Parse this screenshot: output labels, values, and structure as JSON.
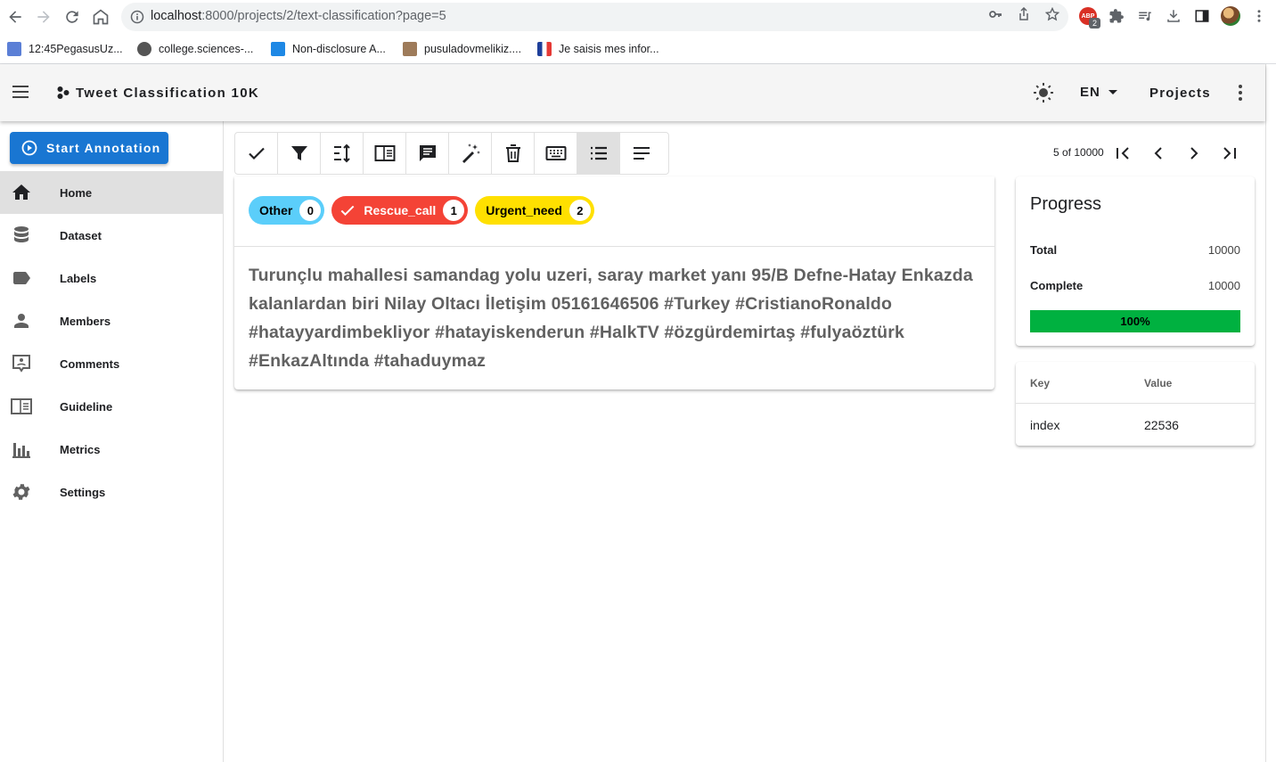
{
  "browser": {
    "url_host": "localhost",
    "url_rest": ":8000/projects/2/text-classification?page=5",
    "abp_label": "ABP",
    "abp_count": "2",
    "bookmarks": [
      {
        "label": "12:45PegasusUz...",
        "color": "#5b7fd6"
      },
      {
        "label": "college.sciences-...",
        "color": "#555555"
      },
      {
        "label": "Non-disclosure A...",
        "color": "#1e88e5"
      },
      {
        "label": "pusuladovmelikiz....",
        "color": "#9e7b5a"
      },
      {
        "label": "Je saisis mes infor...",
        "color": "#e53935"
      }
    ]
  },
  "appbar": {
    "title": "Tweet Classification 10K",
    "language": "EN",
    "projects_label": "Projects"
  },
  "sidebar": {
    "start_label": "Start Annotation",
    "items": [
      {
        "label": "Home",
        "icon": "home-icon",
        "active": true
      },
      {
        "label": "Dataset",
        "icon": "database-icon",
        "active": false
      },
      {
        "label": "Labels",
        "icon": "label-icon",
        "active": false
      },
      {
        "label": "Members",
        "icon": "account-icon",
        "active": false
      },
      {
        "label": "Comments",
        "icon": "comment-icon",
        "active": false
      },
      {
        "label": "Guideline",
        "icon": "book-icon",
        "active": false
      },
      {
        "label": "Metrics",
        "icon": "chart-icon",
        "active": false
      },
      {
        "label": "Settings",
        "icon": "gear-icon",
        "active": false
      }
    ]
  },
  "toolbar": {
    "tools": [
      "check-icon",
      "filter-icon",
      "sort-icon",
      "guideline-icon",
      "comment-icon",
      "auto-label-icon",
      "delete-icon",
      "keyboard-icon",
      "list-view-icon",
      "text-view-icon"
    ],
    "active_tool": "list-view-icon"
  },
  "pager": {
    "text": "5 of 10000"
  },
  "labels": [
    {
      "name": "Other",
      "count": "0",
      "color": "#5bcefa",
      "selected": false
    },
    {
      "name": "Rescue_call",
      "count": "1",
      "color": "#f44336",
      "selected": true
    },
    {
      "name": "Urgent_need",
      "count": "2",
      "color": "#ffe000",
      "selected": false
    }
  ],
  "document": {
    "text": "Turunçlu mahallesi samandag yolu uzeri, saray market yanı 95/B Defne-Hatay Enkazda kalanlardan biri Nilay Oltacı  İletişim 05161646506 #Turkey #CristianoRonaldo #hatayyardimbekliyor #hatayiskenderun #HalkTV #özgürdemirtaş #fulyaöztürk #EnkazAltında #tahaduymaz"
  },
  "progress": {
    "title": "Progress",
    "total_label": "Total",
    "total_value": "10000",
    "complete_label": "Complete",
    "complete_value": "10000",
    "percent_text": "100%",
    "percent": 100
  },
  "metadata": {
    "key_header": "Key",
    "value_header": "Value",
    "rows": [
      {
        "key": "index",
        "value": "22536"
      }
    ]
  }
}
